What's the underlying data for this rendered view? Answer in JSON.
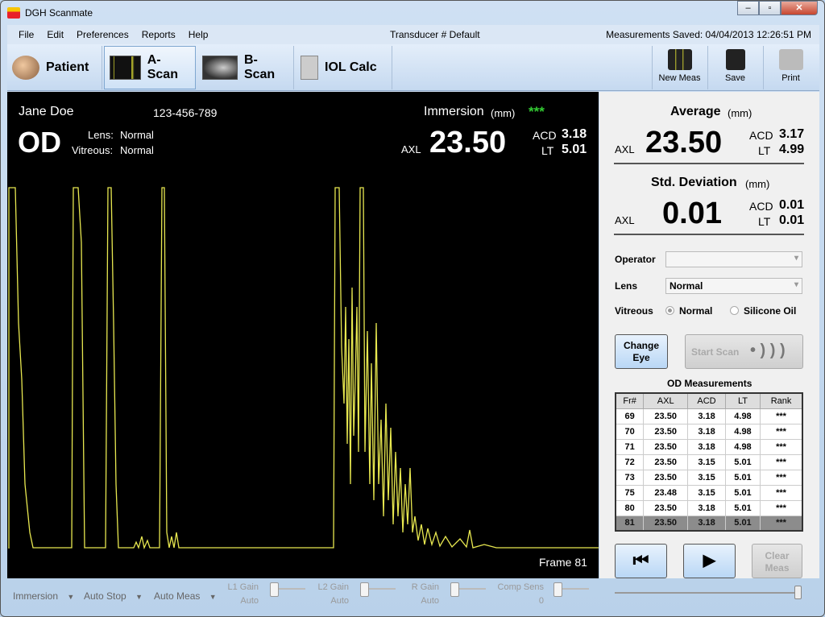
{
  "window": {
    "title": "DGH Scanmate"
  },
  "menu": [
    "File",
    "Edit",
    "Preferences",
    "Reports",
    "Help"
  ],
  "transducer": "Transducer # Default",
  "saved": "Measurements Saved:  04/04/2013  12:26:51  PM",
  "toolbar": {
    "tabs": [
      {
        "label": "Patient",
        "icon": "patient-icon"
      },
      {
        "label": "A-Scan",
        "icon": "a-scan-icon",
        "active": true
      },
      {
        "label": "B-Scan",
        "icon": "b-scan-icon"
      },
      {
        "label": "IOL Calc",
        "icon": "calculator-icon"
      }
    ],
    "actions": [
      {
        "label": "New Meas",
        "icon": "new-meas-icon"
      },
      {
        "label": "Save",
        "icon": "save-icon"
      },
      {
        "label": "Print",
        "icon": "print-icon"
      }
    ]
  },
  "scan": {
    "patient": "Jane Doe",
    "id": "123-456-789",
    "eye": "OD",
    "lens_label": "Lens:",
    "lens": "Normal",
    "vitreous_label": "Vitreous:",
    "vitreous": "Normal",
    "mode": "Immersion",
    "unit": "(mm)",
    "rank": "***",
    "axl_label": "AXL",
    "axl": "23.50",
    "acd_label": "ACD",
    "acd": "3.18",
    "lt_label": "LT",
    "lt": "5.01",
    "frame": "Frame 81",
    "trace_color": "#e8e850"
  },
  "average": {
    "title": "Average",
    "unit": "(mm)",
    "axl_label": "AXL",
    "axl": "23.50",
    "acd_label": "ACD",
    "acd": "3.17",
    "lt_label": "LT",
    "lt": "4.99"
  },
  "stddev": {
    "title": "Std. Deviation",
    "unit": "(mm)",
    "axl_label": "AXL",
    "axl": "0.01",
    "acd_label": "ACD",
    "acd": "0.01",
    "lt_label": "LT",
    "lt": "0.01"
  },
  "form": {
    "operator_label": "Operator",
    "operator": "",
    "lens_label": "Lens",
    "lens": "Normal",
    "vitreous_label": "Vitreous",
    "vitreous_options": [
      "Normal",
      "Silicone Oil"
    ],
    "vitreous_selected": "Normal"
  },
  "buttons": {
    "change_eye": "Change Eye",
    "start_scan": "Start Scan",
    "clear_meas": "Clear Meas"
  },
  "measurements": {
    "title": "OD Measurements",
    "columns": [
      "Fr#",
      "AXL",
      "ACD",
      "LT",
      "Rank"
    ],
    "rows": [
      [
        "69",
        "23.50",
        "3.18",
        "4.98",
        "***"
      ],
      [
        "70",
        "23.50",
        "3.18",
        "4.98",
        "***"
      ],
      [
        "71",
        "23.50",
        "3.18",
        "4.98",
        "***"
      ],
      [
        "72",
        "23.50",
        "3.15",
        "5.01",
        "***"
      ],
      [
        "73",
        "23.50",
        "3.15",
        "5.01",
        "***"
      ],
      [
        "75",
        "23.48",
        "3.15",
        "5.01",
        "***"
      ],
      [
        "80",
        "23.50",
        "3.18",
        "5.01",
        "***"
      ],
      [
        "81",
        "23.50",
        "3.18",
        "5.01",
        "***"
      ]
    ],
    "selected_row": 7
  },
  "bottom": {
    "dropdowns": [
      "Immersion",
      "Auto Stop",
      "Auto Meas"
    ],
    "gains": [
      {
        "label": "L1 Gain",
        "value": "Auto"
      },
      {
        "label": "L2 Gain",
        "value": "Auto"
      },
      {
        "label": "R Gain",
        "value": "Auto"
      },
      {
        "label": "Comp Sens",
        "value": "0"
      }
    ]
  }
}
